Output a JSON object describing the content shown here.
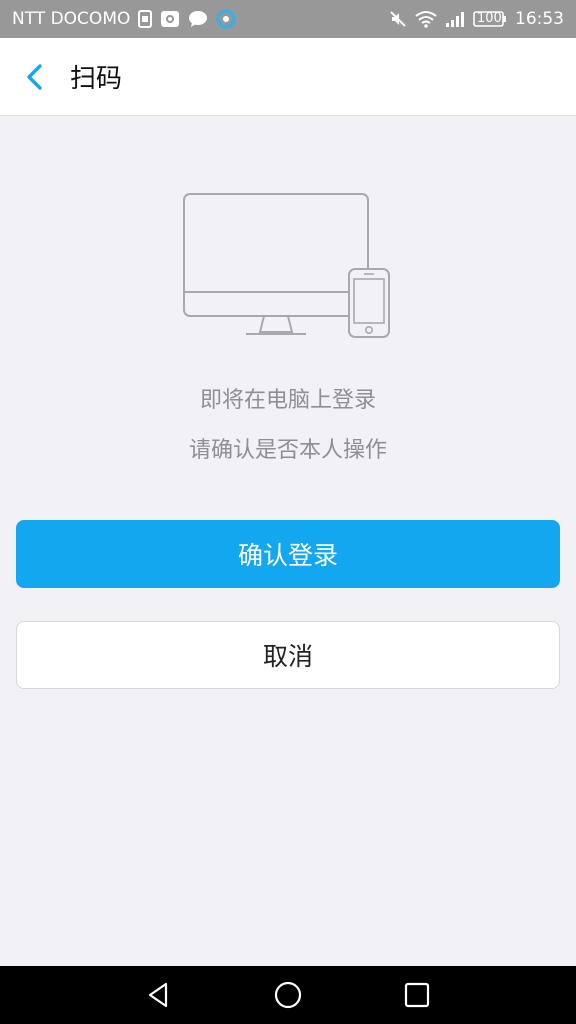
{
  "status_bar": {
    "carrier": "NTT DOCOMO",
    "battery": "100",
    "time": "16:53",
    "left_icons": [
      "sim-icon",
      "camera-app-icon",
      "chat-icon",
      "sync-icon"
    ],
    "right_icons": [
      "mute-icon",
      "wifi-icon",
      "signal-icon",
      "battery-icon"
    ]
  },
  "header": {
    "title": "扫码"
  },
  "main": {
    "message_line1": "即将在电脑上登录",
    "message_line2": "请确认是否本人操作",
    "confirm_label": "确认登录",
    "cancel_label": "取消"
  },
  "colors": {
    "accent": "#12a7ee",
    "background": "#f2f2f6",
    "text_secondary": "#8e8e93"
  }
}
